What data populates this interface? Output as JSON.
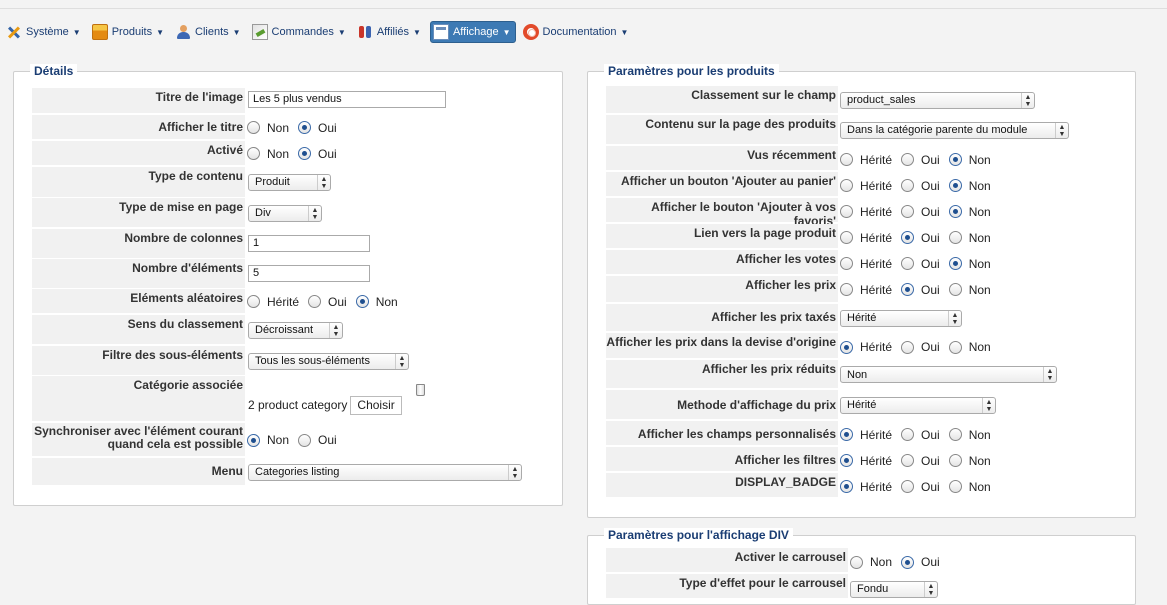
{
  "menu": [
    {
      "label": "Système",
      "icon": "tools-icon"
    },
    {
      "label": "Produits",
      "icon": "products-icon"
    },
    {
      "label": "Clients",
      "icon": "users-icon"
    },
    {
      "label": "Commandes",
      "icon": "orders-icon"
    },
    {
      "label": "Affiliés",
      "icon": "affiliates-icon"
    },
    {
      "label": "Affichage",
      "icon": "display-icon"
    },
    {
      "label": "Documentation",
      "icon": "help-icon"
    }
  ],
  "details": {
    "legend": "Détails",
    "titre_image": {
      "label": "Titre de l'image",
      "value": "Les 5 plus vendus"
    },
    "afficher_titre": {
      "label": "Afficher le titre",
      "opts": [
        "Non",
        "Oui"
      ]
    },
    "active": {
      "label": "Activé",
      "opts": [
        "Non",
        "Oui"
      ]
    },
    "type_contenu": {
      "label": "Type de contenu",
      "value": "Produit"
    },
    "type_mise_en_page": {
      "label": "Type de mise en page",
      "value": "Div"
    },
    "nb_colonnes": {
      "label": "Nombre de colonnes",
      "value": "1"
    },
    "nb_elements": {
      "label": "Nombre d'éléments",
      "value": "5"
    },
    "elements_aleatoires": {
      "label": "Eléments aléatoires",
      "opts": [
        "Hérité",
        "Oui",
        "Non"
      ]
    },
    "sens_classement": {
      "label": "Sens du classement",
      "value": "Décroissant"
    },
    "filtre_sous_elements": {
      "label": "Filtre des sous-éléments",
      "value": "Tous les sous-éléments"
    },
    "categorie_associee": {
      "label": "Catégorie associée",
      "value": "2 product category",
      "button": "Choisir"
    },
    "synchroniser": {
      "label_line1": "Synchroniser avec l'élément courant",
      "label_line2": "quand cela est possible",
      "opts": [
        "Non",
        "Oui"
      ]
    },
    "menu": {
      "label": "Menu",
      "value": "Categories listing"
    }
  },
  "produits": {
    "legend": "Paramètres pour les produits",
    "classement": {
      "label": "Classement sur le champ",
      "value": "product_sales"
    },
    "contenu_page": {
      "label": "Contenu sur la page des produits",
      "value": "Dans la catégorie parente du module"
    },
    "vus_recemment": {
      "label": "Vus récemment",
      "opts": [
        "Hérité",
        "Oui",
        "Non"
      ]
    },
    "bouton_panier": {
      "label": "Afficher un bouton 'Ajouter au panier'",
      "opts": [
        "Hérité",
        "Oui",
        "Non"
      ]
    },
    "bouton_favoris": {
      "label": "Afficher le bouton 'Ajouter à vos favoris'",
      "opts": [
        "Hérité",
        "Oui",
        "Non"
      ]
    },
    "lien_page": {
      "label": "Lien vers la page produit",
      "opts": [
        "Hérité",
        "Oui",
        "Non"
      ]
    },
    "votes": {
      "label": "Afficher les votes",
      "opts": [
        "Hérité",
        "Oui",
        "Non"
      ]
    },
    "prix": {
      "label": "Afficher les prix",
      "opts": [
        "Hérité",
        "Oui",
        "Non"
      ]
    },
    "prix_taxes": {
      "label": "Afficher les prix taxés",
      "value": "Hérité"
    },
    "prix_devise": {
      "label": "Afficher les prix dans la devise d'origine",
      "opts": [
        "Hérité",
        "Oui",
        "Non"
      ]
    },
    "prix_reduits": {
      "label": "Afficher les prix réduits",
      "value": "Non"
    },
    "methode_prix": {
      "label": "Methode d'affichage du prix",
      "value": "Hérité"
    },
    "champs_perso": {
      "label": "Afficher les champs personnalisés",
      "opts": [
        "Hérité",
        "Oui",
        "Non"
      ]
    },
    "filtres": {
      "label": "Afficher les filtres",
      "opts": [
        "Hérité",
        "Oui",
        "Non"
      ]
    },
    "badge": {
      "label": "DISPLAY_BADGE",
      "opts": [
        "Hérité",
        "Oui",
        "Non"
      ]
    }
  },
  "div": {
    "legend": "Paramètres pour l'affichage DIV",
    "carrousel": {
      "label": "Activer le carrousel",
      "opts": [
        "Non",
        "Oui"
      ]
    },
    "effet": {
      "label": "Type d'effet pour le carrousel",
      "value": "Fondu"
    }
  },
  "colors": {
    "accent": "#3d7ab4",
    "legend": "#1a3d73",
    "label_bg": "#f1f1f1"
  }
}
